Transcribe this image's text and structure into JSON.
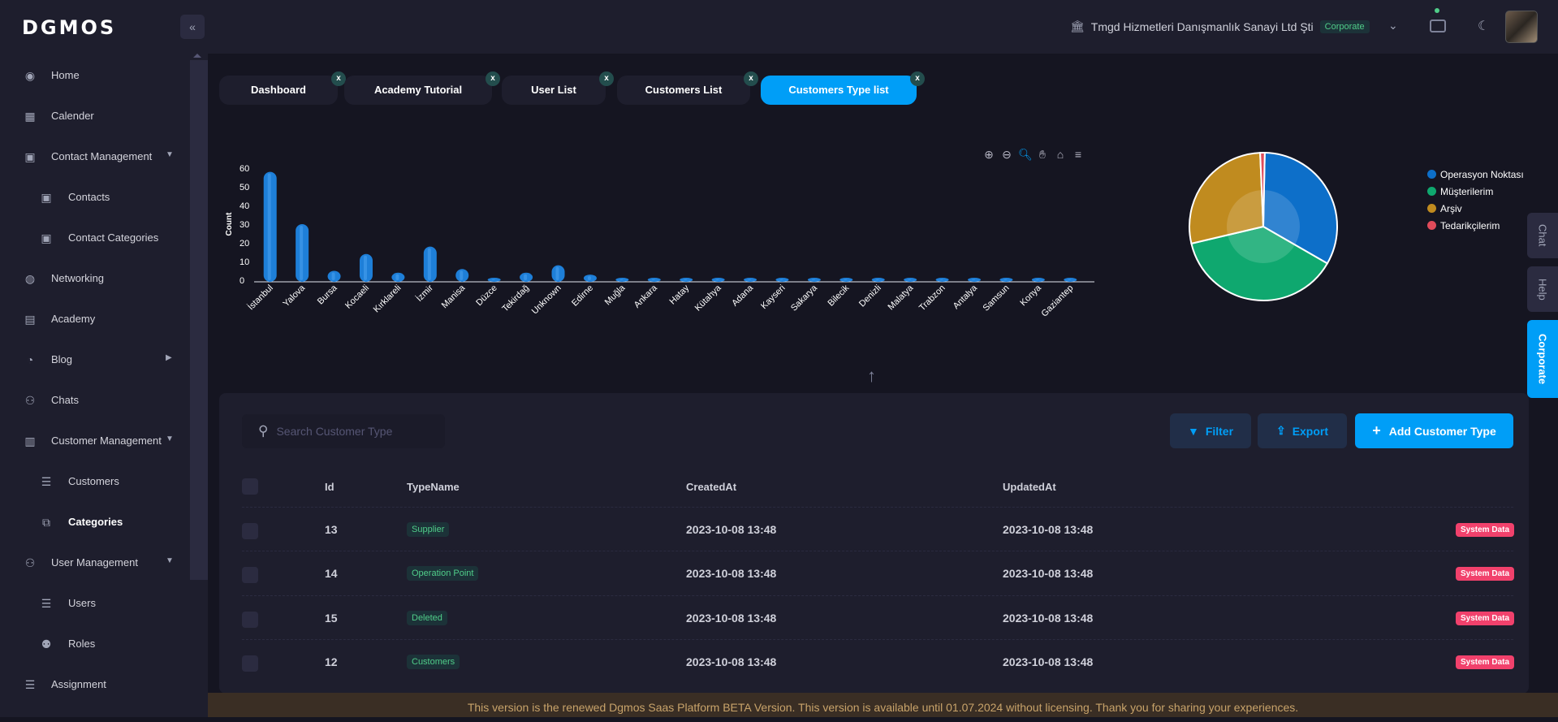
{
  "brand": {
    "logo": "DGMOS"
  },
  "sidebar": {
    "items": [
      {
        "label": "Home",
        "icon": "robot-icon"
      },
      {
        "label": "Calender",
        "icon": "calendar-icon"
      },
      {
        "label": "Contact Management",
        "icon": "contact-book-icon",
        "expanded": true
      },
      {
        "label": "Contacts",
        "icon": "contact-card-icon",
        "sub": true
      },
      {
        "label": "Contact Categories",
        "icon": "contact-card-icon",
        "sub": true
      },
      {
        "label": "Networking",
        "icon": "globe-icon"
      },
      {
        "label": "Academy",
        "icon": "academy-icon"
      },
      {
        "label": "Blog",
        "icon": "blog-icon",
        "collapsed": true
      },
      {
        "label": "Chats",
        "icon": "users-icon"
      },
      {
        "label": "Customer Management",
        "icon": "building-icon",
        "expanded": true
      },
      {
        "label": "Customers",
        "icon": "list-icon",
        "sub": true
      },
      {
        "label": "Categories",
        "icon": "copy-icon",
        "sub": true,
        "active": true
      },
      {
        "label": "User Management",
        "icon": "users-icon",
        "expanded": true
      },
      {
        "label": "Users",
        "icon": "list-icon",
        "sub": true
      },
      {
        "label": "Roles",
        "icon": "user-plus-icon",
        "sub": true
      },
      {
        "label": "Assignment",
        "icon": "list-icon"
      }
    ]
  },
  "header": {
    "company": "Tmgd Hizmetleri Danışmanlık Sanayi Ltd Şti",
    "badge": "Corporate"
  },
  "tabs": [
    {
      "label": "Dashboard",
      "close": "x"
    },
    {
      "label": "Academy Tutorial",
      "close": "x"
    },
    {
      "label": "User List",
      "close": "x"
    },
    {
      "label": "Customers List",
      "close": "x"
    },
    {
      "label": "Customers Type list",
      "close": "x",
      "active": true
    }
  ],
  "chart_data": [
    {
      "type": "bar",
      "ylabel": "Count",
      "ylim": [
        0,
        60
      ],
      "yticks": [
        0,
        10,
        20,
        30,
        40,
        50,
        60
      ],
      "categories": [
        "İstanbul",
        "Yalova",
        "Bursa",
        "Kocaeli",
        "Kırklareli",
        "İzmir",
        "Manisa",
        "Düzce",
        "Tekirdağ",
        "Unknown",
        "Edirne",
        "Muğla",
        "Ankara",
        "Hatay",
        "Kütahya",
        "Adana",
        "Kayseri",
        "Sakarya",
        "Bilecik",
        "Denizli",
        "Malatya",
        "Trabzon",
        "Antalya",
        "Samsun",
        "Konya",
        "Gaziantep"
      ],
      "values": [
        58,
        30,
        5,
        14,
        4,
        18,
        6,
        1,
        4,
        8,
        3,
        0,
        1,
        0,
        0,
        1,
        0,
        0,
        0,
        0,
        0,
        0,
        0,
        0,
        0,
        0
      ],
      "color": "#1e7fd8",
      "grid": false
    },
    {
      "type": "pie",
      "legend_position": "right",
      "labels": [
        "Operasyon Noktası",
        "Müşterilerim",
        "Arşiv",
        "Tedarikçilerim"
      ],
      "values": [
        33,
        38,
        28,
        1
      ],
      "colors": [
        "#0d6fc9",
        "#0fa86f",
        "#c08b1f",
        "#e04b5a"
      ]
    }
  ],
  "search": {
    "placeholder": "Search Customer Type"
  },
  "toolbar": {
    "filter_label": "Filter",
    "export_label": "Export",
    "add_label": "Add Customer Type"
  },
  "table": {
    "columns": [
      "Id",
      "TypeName",
      "CreatedAt",
      "UpdatedAt"
    ],
    "rows": [
      {
        "id": "13",
        "type": "Supplier",
        "created": "2023-10-08 13:48",
        "updated": "2023-10-08 13:48",
        "badge": "System Data"
      },
      {
        "id": "14",
        "type": "Operation Point",
        "created": "2023-10-08 13:48",
        "updated": "2023-10-08 13:48",
        "badge": "System Data"
      },
      {
        "id": "15",
        "type": "Deleted",
        "created": "2023-10-08 13:48",
        "updated": "2023-10-08 13:48",
        "badge": "System Data"
      },
      {
        "id": "12",
        "type": "Customers",
        "created": "2023-10-08 13:48",
        "updated": "2023-10-08 13:48",
        "badge": "System Data"
      }
    ]
  },
  "right_tabs": [
    "Chat",
    "Help",
    "Corporate"
  ],
  "footer": "This version is the renewed Dgmos Saas Platform BETA Version. This version is available until 01.07.2024 without licensing. Thank you for sharing your experiences."
}
